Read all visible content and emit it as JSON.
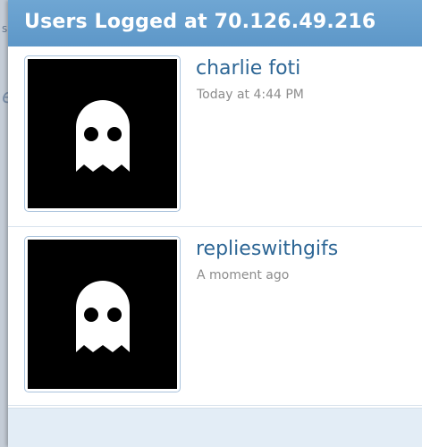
{
  "dialog": {
    "title": "Users Logged at 70.126.49.216"
  },
  "users": [
    {
      "name": "charlie foti",
      "time": "Today at 4:44 PM",
      "avatar_icon": "ghost-icon"
    },
    {
      "name": "replieswithgifs",
      "time": "A moment ago",
      "avatar_icon": "ghost-icon"
    }
  ],
  "colors": {
    "header": "#5d97c8",
    "username": "#2d6695",
    "timestamp": "#8c8c8c"
  }
}
